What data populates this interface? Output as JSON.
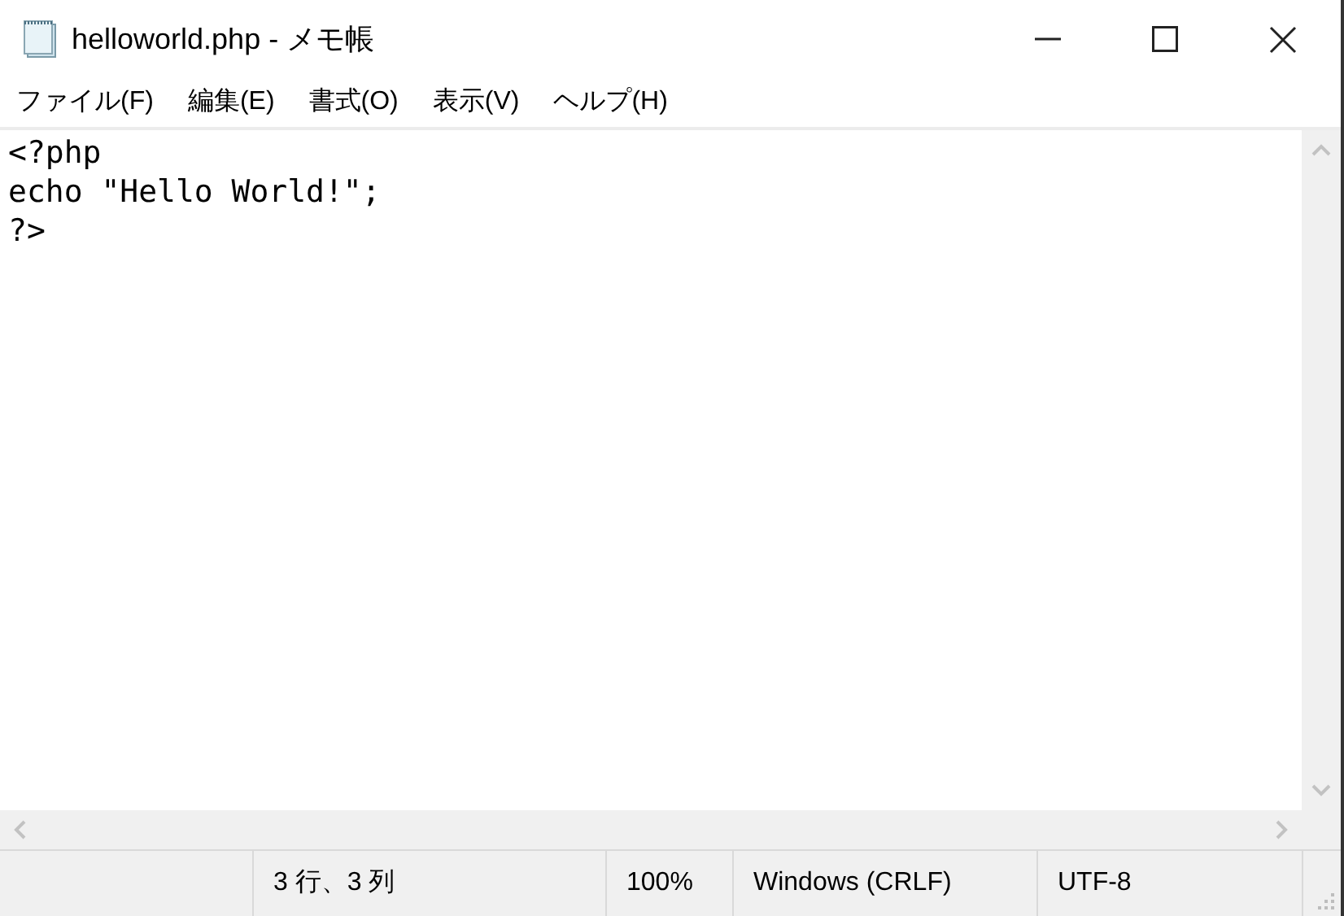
{
  "window": {
    "title": "helloworld.php - メモ帳"
  },
  "menu": [
    "ファイル(F)",
    "編集(E)",
    "書式(O)",
    "表示(V)",
    "ヘルプ(H)"
  ],
  "editor": {
    "lines": [
      "<?php",
      "echo \"Hello World!\";",
      "?>"
    ]
  },
  "status_bar": [
    "3 行、3 列",
    "100%",
    "Windows (CRLF)",
    "UTF-8"
  ]
}
